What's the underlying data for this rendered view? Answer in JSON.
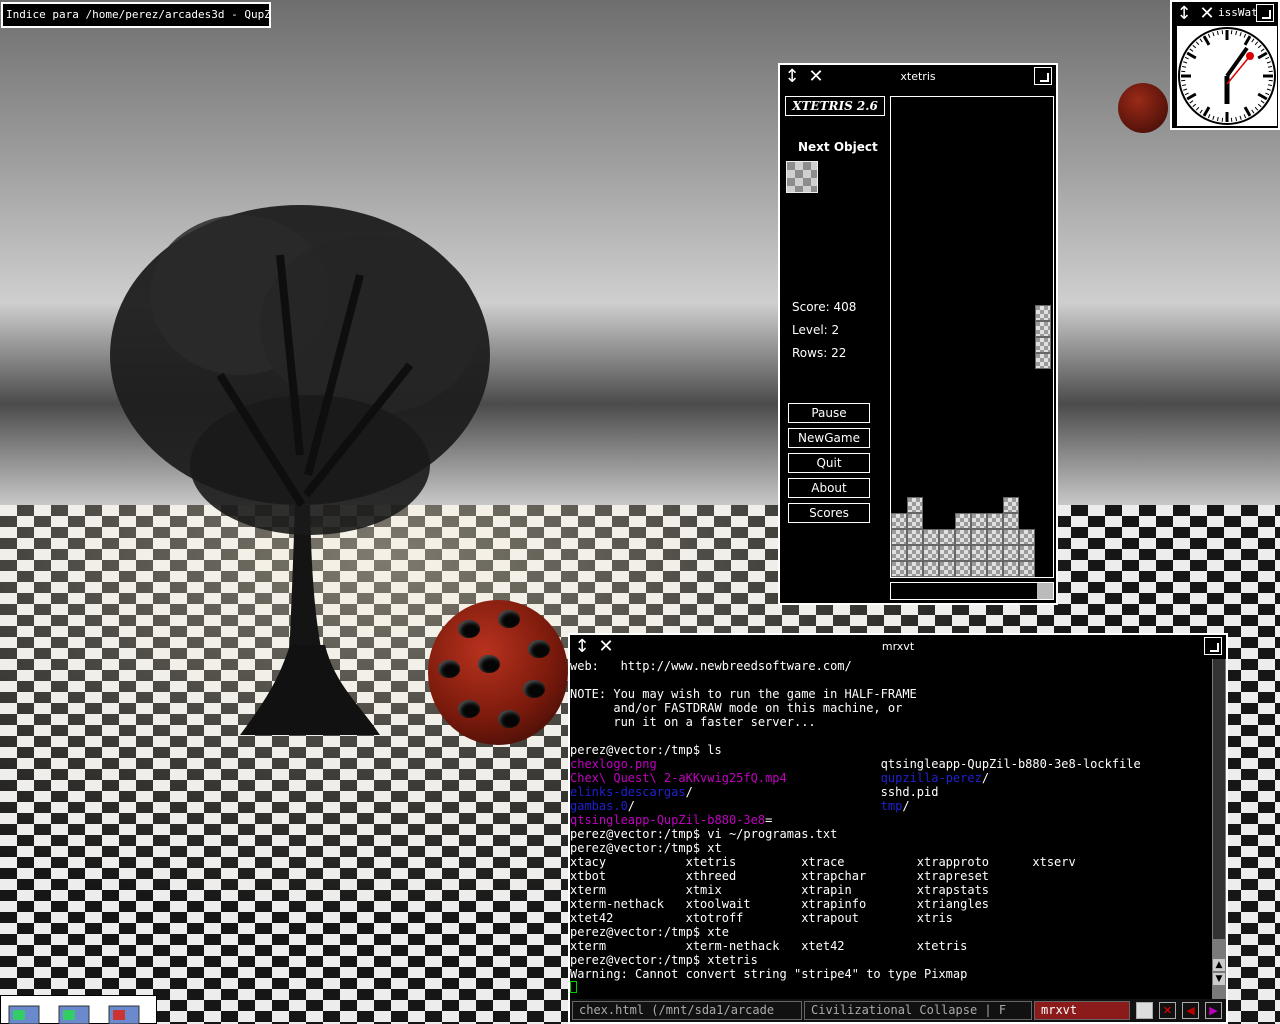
{
  "desktop": {
    "window_title_box": "Indice para /home/perez/arcades3d - QupZilla"
  },
  "xtetris": {
    "window_title": "xtetris",
    "logo": "XTETRIS 2.6",
    "next_label": "Next Object",
    "score": "Score: 408",
    "level": "Level: 2",
    "rows": "Rows: 22",
    "buttons": [
      "Pause",
      "NewGame",
      "Quit",
      "About",
      "Scores"
    ]
  },
  "clock": {
    "window_title": "issWat"
  },
  "terminal": {
    "window_title": "mrxvt",
    "lines": [
      {
        "t": "web:   http://www.newbreedsoftware.com/"
      },
      {
        "t": ""
      },
      {
        "t": "NOTE: You may wish to run the game in HALF-FRAME"
      },
      {
        "t": "      and/or FASTDRAW mode on this machine, or"
      },
      {
        "t": "      run it on a faster server..."
      },
      {
        "t": ""
      },
      {
        "t": "perez@vector:/tmp$ ls"
      },
      {
        "a": "chexlogo.png",
        "ac": "mag",
        "b": "qtsingleapp-QupZil-b880-3e8-lockfile",
        "bc": ""
      },
      {
        "a": "Chex\\ Quest\\ 2-aKKvwig25fQ.mp4",
        "ac": "mag",
        "b": "qupzilla-perez",
        "bc": "blue",
        "bs": "/"
      },
      {
        "a": "elinks-descargas",
        "ac": "blue",
        "as": "/",
        "b": "sshd.pid",
        "bc": ""
      },
      {
        "a": "gambas.0",
        "ac": "blue",
        "as": "/",
        "b": "tmp",
        "bc": "blue",
        "bs": "/"
      },
      {
        "a": "qtsingleapp-QupZil-b880-3e8",
        "ac": "mag",
        "as": "=",
        "b": "",
        "bc": ""
      },
      {
        "t": "perez@vector:/tmp$ vi ~/programas.txt"
      },
      {
        "t": "perez@vector:/tmp$ xt"
      },
      {
        "t": "xtacy           xtetris         xtrace          xtrapproto      xtserv"
      },
      {
        "t": "xtbot           xthreed         xtrapchar       xtrapreset"
      },
      {
        "t": "xterm           xtmix           xtrapin         xtrapstats"
      },
      {
        "t": "xterm-nethack   xtoolwait       xtrapinfo       xtriangles"
      },
      {
        "t": "xtet42          xtotroff        xtrapout        xtris"
      },
      {
        "t": "perez@vector:/tmp$ xte"
      },
      {
        "t": "xterm           xterm-nethack   xtet42          xtetris"
      },
      {
        "t": "perez@vector:/tmp$ xtetris"
      },
      {
        "t": "Warning: Cannot convert string \"stripe4\" to type Pixmap"
      }
    ],
    "tabs": [
      {
        "label": "chex.html (/mnt/sda1/arcade",
        "active": false
      },
      {
        "label": "Civilizational Collapse | F",
        "active": false
      },
      {
        "label": "mrxvt",
        "active": true
      }
    ]
  },
  "colors": {
    "accent_active_tab": "#8b1a1a",
    "dir_color": "#2020d0",
    "file_color": "#c000c0"
  }
}
